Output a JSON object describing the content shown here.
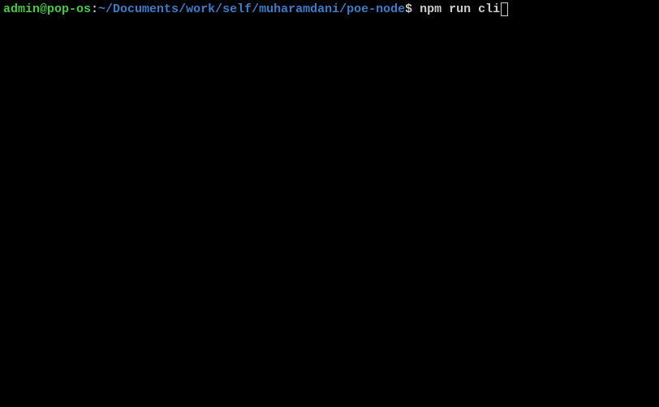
{
  "prompt": {
    "user_host": "admin@pop-os",
    "separator": ":",
    "path": "~/Documents/work/self/muharamdani/poe-node",
    "prompt_symbol": "$ ",
    "command": "npm run cli"
  }
}
